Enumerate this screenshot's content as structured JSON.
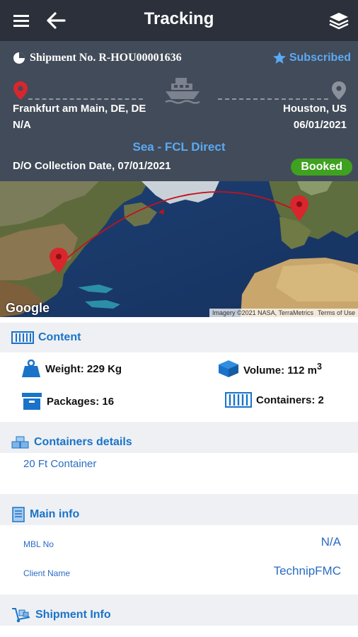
{
  "header": {
    "title": "Tracking"
  },
  "shipment": {
    "number_label": "Shipment No. R-HOU00001636",
    "subscribed_label": "Subscribed",
    "origin_city": "Frankfurt am Main, DE, DE",
    "origin_date": "N/A",
    "destination_city": "Houston, US",
    "destination_date": "06/01/2021",
    "service": "Sea - FCL Direct",
    "do_collection": "D/O Collection Date, 07/01/2021",
    "status": "Booked"
  },
  "map": {
    "logo": "Google",
    "imagery": "Imagery ©2021 NASA, TerraMetrics",
    "terms": "Terms of Use"
  },
  "content": {
    "title": "Content",
    "weight": "Weight: 229 Kg",
    "volume_label": "Volume: 112 m",
    "volume_unit_sup": "3",
    "packages": "Packages: 16",
    "containers": "Containers: 2"
  },
  "containers_details": {
    "title": "Containers details",
    "items": [
      "20 Ft Container"
    ]
  },
  "main_info": {
    "title": "Main info",
    "rows": [
      {
        "label": "MBL No",
        "value": "N/A"
      },
      {
        "label": "Client Name",
        "value": "TechnipFMC"
      }
    ]
  },
  "shipment_info": {
    "title": "Shipment Info"
  },
  "colors": {
    "header_bg": "#2b303a",
    "summary_bg": "#424b59",
    "accent_blue": "#1a73c9",
    "status_green": "#3ea11f",
    "pin_red": "#d9262c"
  }
}
